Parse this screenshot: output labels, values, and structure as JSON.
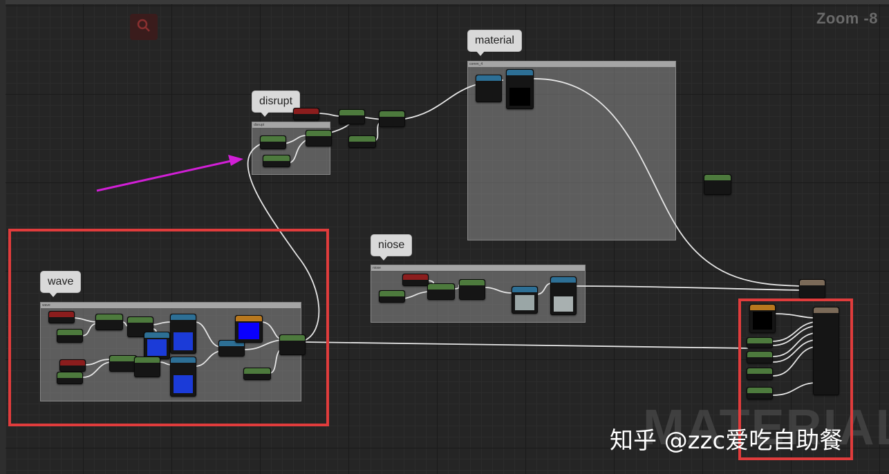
{
  "header": {
    "zoom_label": "Zoom -8"
  },
  "toolbar": {
    "search_icon": "search-icon"
  },
  "comments": {
    "material": {
      "label": "material",
      "bar_text": "comm_4"
    },
    "disrupt": {
      "label": "disrupt",
      "bar_text": "disrupt"
    },
    "niose": {
      "label": "niose",
      "bar_text": "niose"
    },
    "wave": {
      "label": "wave",
      "bar_text": "wave"
    }
  },
  "output_node_watermark": "MATERIAL",
  "watermark": "知乎 @zzc爱吃自助餐",
  "colors": {
    "highlight_box": "#e03c3c",
    "arrow": "#d11fd6",
    "wire": "#e6e6e6",
    "texture_pin": "#2d6f95",
    "scalar_pin": "#4d7a3d",
    "param_pin": "#8b1d1d"
  }
}
